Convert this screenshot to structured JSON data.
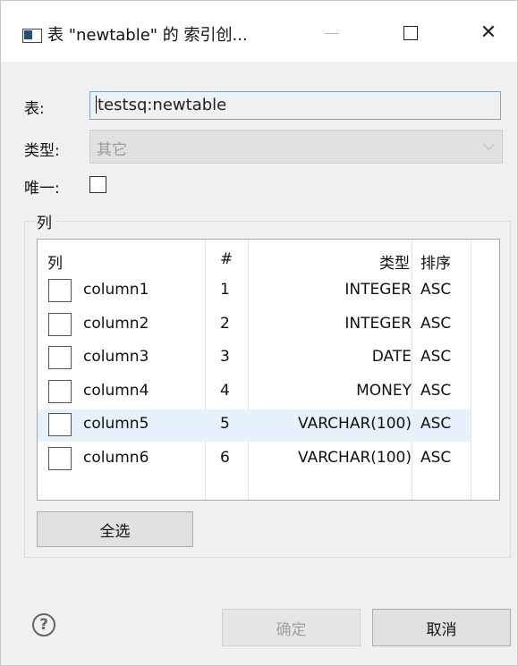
{
  "window": {
    "title": "表 \"newtable\" 的 索引创...",
    "close_glyph": "✕"
  },
  "form": {
    "table_label": "表:",
    "table_value": "testsq:newtable",
    "type_label": "类型:",
    "type_value": "其它",
    "unique_label": "唯一:",
    "unique_checked": false
  },
  "columns_group": {
    "title": "列",
    "headers": {
      "column": "列",
      "number": "#",
      "type": "类型",
      "order": "排序"
    },
    "rows": [
      {
        "name": "column1",
        "num": "1",
        "type": "INTEGER",
        "order": "ASC",
        "checked": false,
        "selected": false
      },
      {
        "name": "column2",
        "num": "2",
        "type": "INTEGER",
        "order": "ASC",
        "checked": false,
        "selected": false
      },
      {
        "name": "column3",
        "num": "3",
        "type": "DATE",
        "order": "ASC",
        "checked": false,
        "selected": false
      },
      {
        "name": "column4",
        "num": "4",
        "type": "MONEY",
        "order": "ASC",
        "checked": false,
        "selected": false
      },
      {
        "name": "column5",
        "num": "5",
        "type": "VARCHAR(100)",
        "order": "ASC",
        "checked": false,
        "selected": true
      },
      {
        "name": "column6",
        "num": "6",
        "type": "VARCHAR(100)",
        "order": "ASC",
        "checked": false,
        "selected": false
      }
    ],
    "select_all_label": "全选"
  },
  "footer": {
    "help_glyph": "?",
    "ok_label": "确定",
    "cancel_label": "取消"
  },
  "colors": {
    "selected_row": "#e6f1fc",
    "focus_border": "#7aa7d9"
  }
}
